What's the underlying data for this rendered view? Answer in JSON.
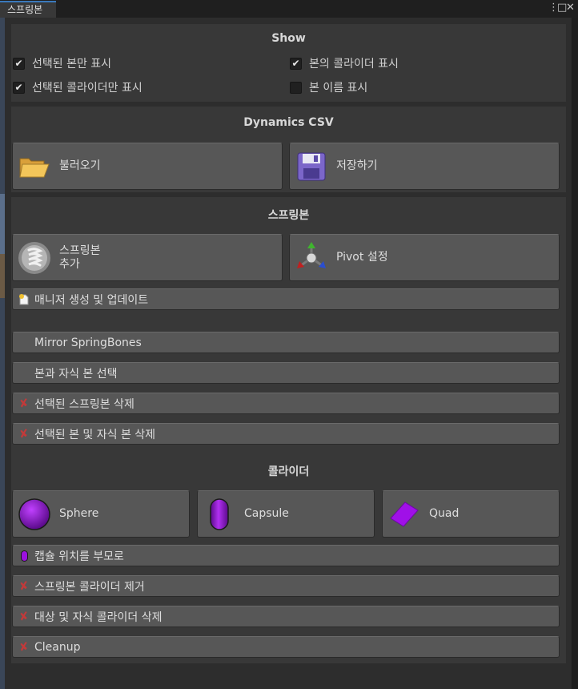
{
  "tab": {
    "title": "스프링본"
  },
  "window_icons": {
    "menu": "⋮",
    "maximize": "□",
    "close": "✕"
  },
  "show": {
    "title": "Show",
    "options": [
      {
        "label": "선택된 본만 표시",
        "checked": true
      },
      {
        "label": "본의 콜라이더 표시",
        "checked": true
      },
      {
        "label": "선택된 콜라이더만 표시",
        "checked": true
      },
      {
        "label": "본 이름 표시",
        "checked": false
      }
    ]
  },
  "csv": {
    "title": "Dynamics CSV",
    "load_label": "불러오기",
    "save_label": "저장하기"
  },
  "springbone": {
    "title": "스프링본",
    "add_label": "스프링본\n추가",
    "pivot_label": "Pivot 설정",
    "manager_label": "매니저 생성 및 업데이트",
    "mirror_label": "Mirror SpringBones",
    "select_children_label": "본과 자식 본 선택",
    "delete_selected_label": "선택된 스프링본 삭제",
    "delete_bone_children_label": "선택된 본 및 자식 본 삭제"
  },
  "collider": {
    "title": "콜라이더",
    "sphere_label": "Sphere",
    "capsule_label": "Capsule",
    "quad_label": "Quad",
    "capsule_parent_label": "캡슐 위치를 부모로",
    "remove_label": "스프링본 콜라이더 제거",
    "delete_target_label": "대상 및 자식 콜라이더 삭제",
    "cleanup_label": "Cleanup"
  },
  "colors": {
    "accent": "#3a79bb",
    "collider_purple": "#9b10e0",
    "delete_red": "#c23a3a"
  }
}
